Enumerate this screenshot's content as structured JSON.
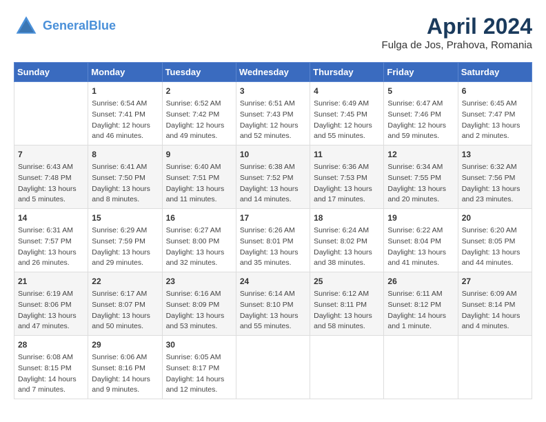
{
  "header": {
    "logo_line1": "General",
    "logo_line2": "Blue",
    "month": "April 2024",
    "location": "Fulga de Jos, Prahova, Romania"
  },
  "weekdays": [
    "Sunday",
    "Monday",
    "Tuesday",
    "Wednesday",
    "Thursday",
    "Friday",
    "Saturday"
  ],
  "weeks": [
    [
      {
        "day": "",
        "info": ""
      },
      {
        "day": "1",
        "info": "Sunrise: 6:54 AM\nSunset: 7:41 PM\nDaylight: 12 hours\nand 46 minutes."
      },
      {
        "day": "2",
        "info": "Sunrise: 6:52 AM\nSunset: 7:42 PM\nDaylight: 12 hours\nand 49 minutes."
      },
      {
        "day": "3",
        "info": "Sunrise: 6:51 AM\nSunset: 7:43 PM\nDaylight: 12 hours\nand 52 minutes."
      },
      {
        "day": "4",
        "info": "Sunrise: 6:49 AM\nSunset: 7:45 PM\nDaylight: 12 hours\nand 55 minutes."
      },
      {
        "day": "5",
        "info": "Sunrise: 6:47 AM\nSunset: 7:46 PM\nDaylight: 12 hours\nand 59 minutes."
      },
      {
        "day": "6",
        "info": "Sunrise: 6:45 AM\nSunset: 7:47 PM\nDaylight: 13 hours\nand 2 minutes."
      }
    ],
    [
      {
        "day": "7",
        "info": "Sunrise: 6:43 AM\nSunset: 7:48 PM\nDaylight: 13 hours\nand 5 minutes."
      },
      {
        "day": "8",
        "info": "Sunrise: 6:41 AM\nSunset: 7:50 PM\nDaylight: 13 hours\nand 8 minutes."
      },
      {
        "day": "9",
        "info": "Sunrise: 6:40 AM\nSunset: 7:51 PM\nDaylight: 13 hours\nand 11 minutes."
      },
      {
        "day": "10",
        "info": "Sunrise: 6:38 AM\nSunset: 7:52 PM\nDaylight: 13 hours\nand 14 minutes."
      },
      {
        "day": "11",
        "info": "Sunrise: 6:36 AM\nSunset: 7:53 PM\nDaylight: 13 hours\nand 17 minutes."
      },
      {
        "day": "12",
        "info": "Sunrise: 6:34 AM\nSunset: 7:55 PM\nDaylight: 13 hours\nand 20 minutes."
      },
      {
        "day": "13",
        "info": "Sunrise: 6:32 AM\nSunset: 7:56 PM\nDaylight: 13 hours\nand 23 minutes."
      }
    ],
    [
      {
        "day": "14",
        "info": "Sunrise: 6:31 AM\nSunset: 7:57 PM\nDaylight: 13 hours\nand 26 minutes."
      },
      {
        "day": "15",
        "info": "Sunrise: 6:29 AM\nSunset: 7:59 PM\nDaylight: 13 hours\nand 29 minutes."
      },
      {
        "day": "16",
        "info": "Sunrise: 6:27 AM\nSunset: 8:00 PM\nDaylight: 13 hours\nand 32 minutes."
      },
      {
        "day": "17",
        "info": "Sunrise: 6:26 AM\nSunset: 8:01 PM\nDaylight: 13 hours\nand 35 minutes."
      },
      {
        "day": "18",
        "info": "Sunrise: 6:24 AM\nSunset: 8:02 PM\nDaylight: 13 hours\nand 38 minutes."
      },
      {
        "day": "19",
        "info": "Sunrise: 6:22 AM\nSunset: 8:04 PM\nDaylight: 13 hours\nand 41 minutes."
      },
      {
        "day": "20",
        "info": "Sunrise: 6:20 AM\nSunset: 8:05 PM\nDaylight: 13 hours\nand 44 minutes."
      }
    ],
    [
      {
        "day": "21",
        "info": "Sunrise: 6:19 AM\nSunset: 8:06 PM\nDaylight: 13 hours\nand 47 minutes."
      },
      {
        "day": "22",
        "info": "Sunrise: 6:17 AM\nSunset: 8:07 PM\nDaylight: 13 hours\nand 50 minutes."
      },
      {
        "day": "23",
        "info": "Sunrise: 6:16 AM\nSunset: 8:09 PM\nDaylight: 13 hours\nand 53 minutes."
      },
      {
        "day": "24",
        "info": "Sunrise: 6:14 AM\nSunset: 8:10 PM\nDaylight: 13 hours\nand 55 minutes."
      },
      {
        "day": "25",
        "info": "Sunrise: 6:12 AM\nSunset: 8:11 PM\nDaylight: 13 hours\nand 58 minutes."
      },
      {
        "day": "26",
        "info": "Sunrise: 6:11 AM\nSunset: 8:12 PM\nDaylight: 14 hours\nand 1 minute."
      },
      {
        "day": "27",
        "info": "Sunrise: 6:09 AM\nSunset: 8:14 PM\nDaylight: 14 hours\nand 4 minutes."
      }
    ],
    [
      {
        "day": "28",
        "info": "Sunrise: 6:08 AM\nSunset: 8:15 PM\nDaylight: 14 hours\nand 7 minutes."
      },
      {
        "day": "29",
        "info": "Sunrise: 6:06 AM\nSunset: 8:16 PM\nDaylight: 14 hours\nand 9 minutes."
      },
      {
        "day": "30",
        "info": "Sunrise: 6:05 AM\nSunset: 8:17 PM\nDaylight: 14 hours\nand 12 minutes."
      },
      {
        "day": "",
        "info": ""
      },
      {
        "day": "",
        "info": ""
      },
      {
        "day": "",
        "info": ""
      },
      {
        "day": "",
        "info": ""
      }
    ]
  ]
}
